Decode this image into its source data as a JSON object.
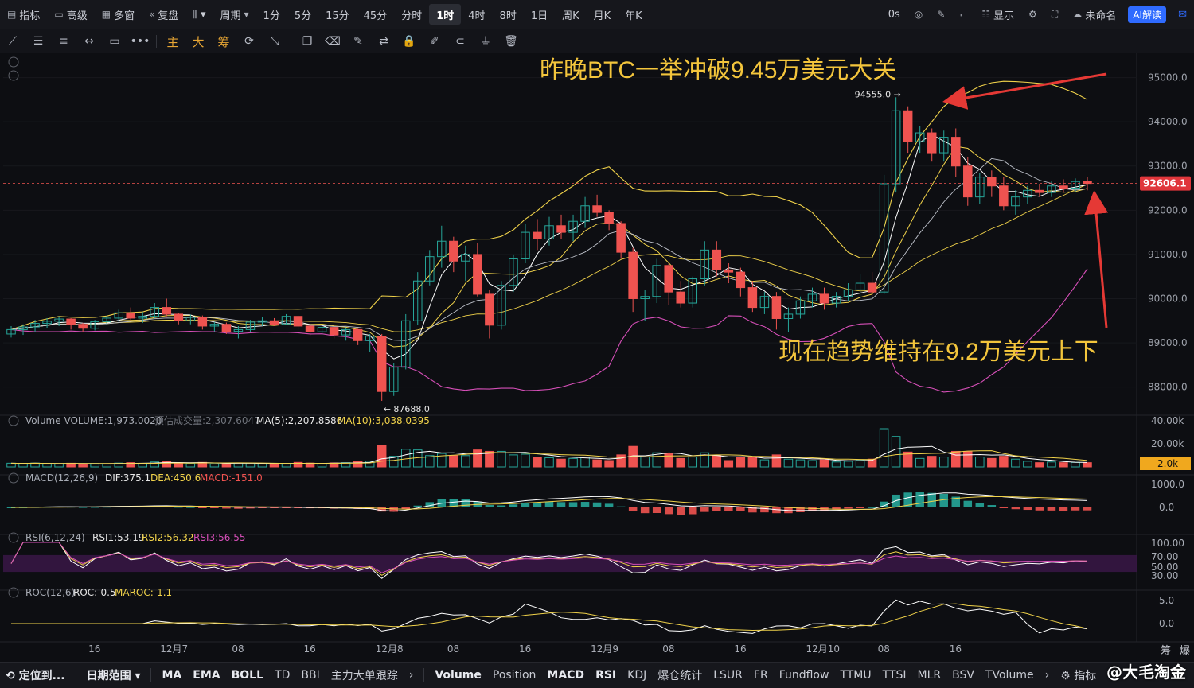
{
  "topbar": {
    "left_items": [
      {
        "icon": "chart-icon",
        "label": "指标"
      },
      {
        "icon": "advanced-icon",
        "label": "高级"
      },
      {
        "icon": "multi-window-icon",
        "label": "多窗"
      },
      {
        "icon": "replay-icon",
        "label": "复盘"
      },
      {
        "icon": "candle-type-icon",
        "label": "▾"
      }
    ],
    "period_label": "周期",
    "intervals": [
      "1分",
      "5分",
      "15分",
      "45分",
      "分时",
      "1时",
      "4时",
      "8时",
      "1日",
      "周K",
      "月K",
      "年K"
    ],
    "active_interval": "1时",
    "right_items": [
      {
        "icon": "countdown-icon",
        "label": "0s"
      },
      {
        "icon": "camera-icon",
        "label": ""
      },
      {
        "icon": "pen-icon",
        "label": ""
      },
      {
        "icon": "select-icon",
        "label": ""
      },
      {
        "icon": "display-icon",
        "label": "显示"
      },
      {
        "icon": "gear-icon",
        "label": ""
      },
      {
        "icon": "fullscreen-icon",
        "label": ""
      },
      {
        "icon": "cloud-icon",
        "label": "未命名"
      }
    ],
    "ai_label": "AI解读"
  },
  "drawing_tools": [
    {
      "name": "line-tool-icon",
      "glyph": "⟋"
    },
    {
      "name": "parallel-lines-icon",
      "glyph": "☰"
    },
    {
      "name": "horizontal-lines-icon",
      "glyph": "≡"
    },
    {
      "name": "horizontal-ray-icon",
      "glyph": "↔"
    },
    {
      "name": "rectangle-icon",
      "glyph": "▭"
    },
    {
      "name": "more-shapes-icon",
      "glyph": "•••"
    },
    {
      "name": "main-label",
      "glyph": "主"
    },
    {
      "name": "big-label",
      "glyph": "大"
    },
    {
      "name": "chip-label",
      "glyph": "筹"
    },
    {
      "name": "sync-icon",
      "glyph": "⟳"
    },
    {
      "name": "measure-icon",
      "glyph": "⤡"
    },
    {
      "name": "copy-icon",
      "glyph": "❐"
    },
    {
      "name": "eraser-icon",
      "glyph": "⌫"
    },
    {
      "name": "brush-icon",
      "glyph": "✎"
    },
    {
      "name": "compare-icon",
      "glyph": "⇄"
    },
    {
      "name": "lock-icon",
      "glyph": "🔒"
    },
    {
      "name": "note-icon",
      "glyph": "✐"
    },
    {
      "name": "magnet-icon",
      "glyph": "⊂"
    },
    {
      "name": "filter-icon",
      "glyph": "⏚"
    },
    {
      "name": "trash-icon",
      "glyph": "🗑"
    }
  ],
  "chart_data": {
    "type": "candlestick",
    "title": "",
    "annotations": {
      "top": "昨晚BTC一举冲破9.45万美元大关",
      "right": "现在趋势维持在9.2万美元上下",
      "high_label": "94555.0",
      "low_label": "87688.0"
    },
    "last_price": "92606.1",
    "last_price_value": 92606.1,
    "price_axis": {
      "ticks": [
        95000,
        94000,
        93000,
        92000,
        91000,
        90000,
        89000,
        88000
      ],
      "tick_labels": [
        "95000.0",
        "94000.0",
        "93000.0",
        "92000.0",
        "91000.0",
        "90000.0",
        "89000.0",
        "88000.0"
      ],
      "ylim": [
        87400,
        95550
      ]
    },
    "x_axis_labels": [
      {
        "index": 7,
        "label": "16"
      },
      {
        "index": 13,
        "label": "12月7"
      },
      {
        "index": 19,
        "label": "08"
      },
      {
        "index": 25,
        "label": "16"
      },
      {
        "index": 31,
        "label": "12月8"
      },
      {
        "index": 37,
        "label": "08"
      },
      {
        "index": 43,
        "label": "16"
      },
      {
        "index": 49,
        "label": "12月9"
      },
      {
        "index": 55,
        "label": "08"
      },
      {
        "index": 61,
        "label": "16"
      },
      {
        "index": 67,
        "label": "12月10"
      },
      {
        "index": 73,
        "label": "08"
      },
      {
        "index": 79,
        "label": "16"
      }
    ],
    "candles": [
      [
        89200,
        89380,
        89120,
        89300
      ],
      [
        89300,
        89420,
        89180,
        89360
      ],
      [
        89360,
        89520,
        89250,
        89440
      ],
      [
        89440,
        89560,
        89330,
        89490
      ],
      [
        89490,
        89600,
        89380,
        89540
      ],
      [
        89540,
        89560,
        89300,
        89420
      ],
      [
        89420,
        89450,
        89250,
        89330
      ],
      [
        89330,
        89520,
        89280,
        89480
      ],
      [
        89480,
        89620,
        89400,
        89560
      ],
      [
        89560,
        89750,
        89480,
        89680
      ],
      [
        89680,
        89800,
        89500,
        89560
      ],
      [
        89560,
        89700,
        89450,
        89600
      ],
      [
        89600,
        89900,
        89550,
        89800
      ],
      [
        89800,
        90000,
        89600,
        89650
      ],
      [
        89650,
        89680,
        89420,
        89500
      ],
      [
        89500,
        89640,
        89420,
        89580
      ],
      [
        89580,
        89620,
        89300,
        89380
      ],
      [
        89380,
        89470,
        89260,
        89420
      ],
      [
        89420,
        89460,
        89200,
        89260
      ],
      [
        89260,
        89380,
        89100,
        89300
      ],
      [
        89300,
        89520,
        89250,
        89470
      ],
      [
        89470,
        89580,
        89380,
        89500
      ],
      [
        89500,
        89560,
        89380,
        89420
      ],
      [
        89420,
        89650,
        89400,
        89600
      ],
      [
        89600,
        89620,
        89300,
        89380
      ],
      [
        89380,
        89420,
        89150,
        89250
      ],
      [
        89250,
        89400,
        89180,
        89350
      ],
      [
        89350,
        89380,
        89100,
        89180
      ],
      [
        89180,
        89350,
        89050,
        89300
      ],
      [
        89300,
        89320,
        88950,
        89050
      ],
      [
        89050,
        89200,
        88800,
        89150
      ],
      [
        89150,
        89200,
        87688,
        87900
      ],
      [
        87900,
        88550,
        87800,
        88450
      ],
      [
        88450,
        89650,
        88400,
        89500
      ],
      [
        89500,
        90600,
        89400,
        90400
      ],
      [
        90400,
        91100,
        90300,
        90950
      ],
      [
        90950,
        91650,
        90700,
        91300
      ],
      [
        91300,
        91400,
        90600,
        90850
      ],
      [
        90850,
        91200,
        90400,
        91000
      ],
      [
        91000,
        91250,
        90050,
        90100
      ],
      [
        90100,
        90200,
        89100,
        89400
      ],
      [
        89400,
        90400,
        89300,
        90300
      ],
      [
        90300,
        91000,
        90150,
        90900
      ],
      [
        90900,
        91700,
        90800,
        91500
      ],
      [
        91500,
        91800,
        91100,
        91350
      ],
      [
        91350,
        91850,
        91200,
        91650
      ],
      [
        91650,
        91900,
        91350,
        91500
      ],
      [
        91500,
        91900,
        91300,
        91750
      ],
      [
        91750,
        92300,
        91600,
        92100
      ],
      [
        92100,
        92350,
        91850,
        91950
      ],
      [
        91950,
        92000,
        91550,
        91700
      ],
      [
        91700,
        91750,
        90900,
        91050
      ],
      [
        91050,
        91150,
        89700,
        90000
      ],
      [
        90000,
        90200,
        89500,
        90050
      ],
      [
        90050,
        90900,
        89900,
        90750
      ],
      [
        90750,
        90800,
        89850,
        90150
      ],
      [
        90150,
        90400,
        89800,
        89900
      ],
      [
        89900,
        90500,
        89800,
        90450
      ],
      [
        90450,
        91300,
        90300,
        91100
      ],
      [
        91100,
        91300,
        90500,
        90650
      ],
      [
        90650,
        90800,
        90350,
        90600
      ],
      [
        90600,
        90700,
        90050,
        90250
      ],
      [
        90250,
        90400,
        89700,
        89800
      ],
      [
        89800,
        90150,
        89650,
        90050
      ],
      [
        90050,
        90150,
        89300,
        89550
      ],
      [
        89550,
        89800,
        89250,
        89650
      ],
      [
        89650,
        90050,
        89550,
        89950
      ],
      [
        89950,
        90250,
        89800,
        90100
      ],
      [
        90100,
        90250,
        89750,
        89900
      ],
      [
        89900,
        90150,
        89800,
        90050
      ],
      [
        90050,
        90350,
        89950,
        90200
      ],
      [
        90200,
        90550,
        90050,
        90350
      ],
      [
        90350,
        90600,
        90050,
        90150
      ],
      [
        90150,
        92800,
        90100,
        92600
      ],
      [
        92600,
        94555,
        92400,
        94250
      ],
      [
        94250,
        94350,
        93300,
        93550
      ],
      [
        93550,
        93900,
        93300,
        93750
      ],
      [
        93750,
        93850,
        93100,
        93300
      ],
      [
        93300,
        93800,
        93100,
        93650
      ],
      [
        93650,
        93850,
        92750,
        93000
      ],
      [
        93000,
        93200,
        92100,
        92300
      ],
      [
        92300,
        92850,
        92150,
        92750
      ],
      [
        92750,
        92900,
        92300,
        92550
      ],
      [
        92550,
        92750,
        92000,
        92100
      ],
      [
        92100,
        92450,
        91900,
        92300
      ],
      [
        92300,
        92550,
        92150,
        92450
      ],
      [
        92450,
        92600,
        92300,
        92400
      ],
      [
        92400,
        92650,
        92300,
        92550
      ],
      [
        92550,
        92700,
        92400,
        92500
      ],
      [
        92500,
        92720,
        92400,
        92650
      ],
      [
        92650,
        92750,
        92450,
        92606.1
      ]
    ],
    "volume": {
      "label": "Volume",
      "title_text": "VOLUME:1,973.0020",
      "est_text": "预估成交量:2,307.6047",
      "ma5_text": "MA(5):2,207.8586",
      "ma10_text": "MA(10):3,038.0395",
      "ticks": [
        "40.00k",
        "20.00k"
      ],
      "current": "2.0k",
      "ylim": [
        0,
        45000
      ]
    },
    "macd": {
      "label": "MACD(12,26,9)",
      "dif_text": "DIF:375.1",
      "dea_text": "DEA:450.6",
      "macd_text": "MACD:-151.0",
      "ticks": [
        "1000.0",
        "0.0"
      ]
    },
    "rsi": {
      "label": "RSI(6,12,24)",
      "rsi1_text": "RSI1:53.19",
      "rsi2_text": "RSI2:56.32",
      "rsi3_text": "RSI3:56.55",
      "ticks": [
        "100.00",
        "70.00",
        "50.00",
        "30.00"
      ]
    },
    "roc": {
      "label": "ROC(12,6)",
      "roc_text": "ROC:-0.5",
      "maroc_text": "MAROC:-1.1",
      "ticks": [
        "5.0",
        "0.0"
      ]
    },
    "colors": {
      "up": "#26a69a",
      "down": "#ef5350",
      "ma_white": "#e6e6e6",
      "ma_yellow": "#f0d24a",
      "boll_lower": "#d64fb8",
      "annotation": "#f3c53c"
    }
  },
  "bottombar": {
    "locate_label": "定位到...",
    "range_label": "日期范围",
    "indicators_a": [
      "MA",
      "EMA",
      "BOLL",
      "TD",
      "BBI",
      "主力大单跟踪"
    ],
    "indicators_b": [
      "Volume",
      "Position",
      "MACD",
      "RSI",
      "KDJ",
      "爆仓统计",
      "LSUR",
      "FR",
      "Fundflow",
      "TTMU",
      "TTSI",
      "MLR",
      "BSV",
      "TVolume"
    ],
    "right_label": "指标",
    "watermark": "@大毛淘金",
    "axis_corner_a": "筹",
    "axis_corner_b": "爆"
  }
}
